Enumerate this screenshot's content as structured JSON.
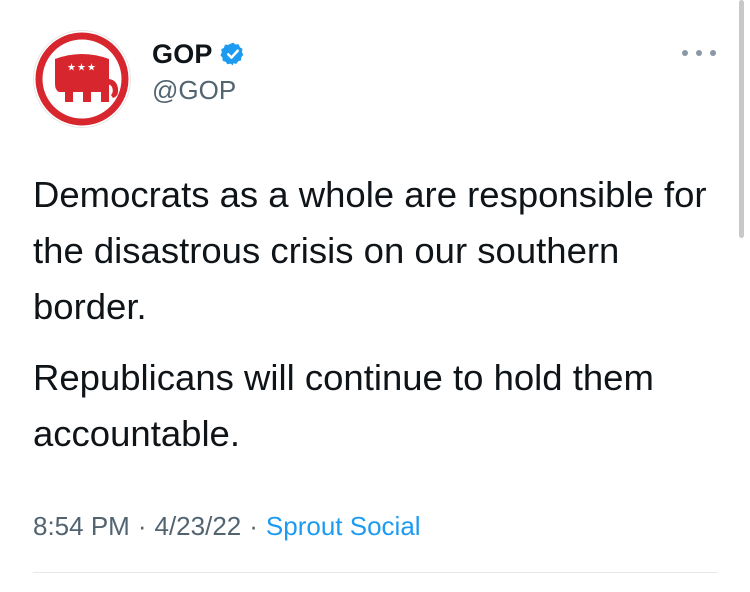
{
  "tweet": {
    "author": {
      "display_name": "GOP",
      "handle": "@GOP",
      "verified": true,
      "avatar_icon": "gop-elephant-logo"
    },
    "more_icon": "more-horizontal-icon",
    "paragraphs": [
      "Democrats as a whole are responsible for the disastrous crisis on our southern border.",
      "Republicans will continue to hold them accountable."
    ],
    "meta": {
      "time": "8:54 PM",
      "separator": "·",
      "date": "4/23/22",
      "source": "Sprout Social"
    }
  },
  "colors": {
    "logo_red": "#d7262d",
    "verified_blue": "#1d9bf0",
    "link_blue": "#1d9bf0",
    "secondary_text": "#536471"
  }
}
